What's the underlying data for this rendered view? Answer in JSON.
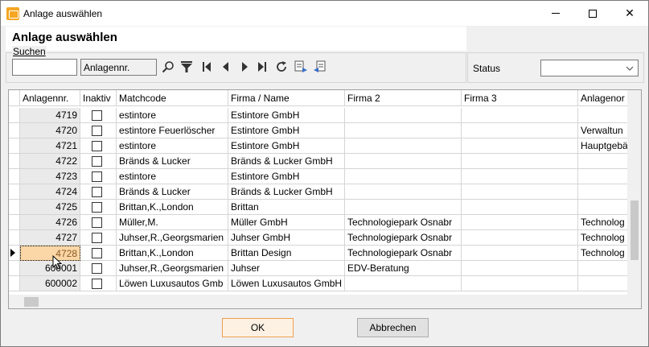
{
  "window": {
    "title": "Anlage auswählen"
  },
  "page": {
    "title": "Anlage auswählen"
  },
  "search": {
    "legend": "Suchen",
    "value": "",
    "field": "Anlagennr."
  },
  "status": {
    "label": "Status",
    "value": ""
  },
  "columns": [
    "Anlagennr.",
    "Inaktiv",
    "Matchcode",
    "Firma / Name",
    "Firma 2",
    "Firma 3",
    "Anlagenor"
  ],
  "rows": [
    {
      "nr": "4719",
      "matchcode": "estintore",
      "firma": "Estintore GmbH",
      "firma2": "",
      "firma3": "",
      "ort": ""
    },
    {
      "nr": "4720",
      "matchcode": "estintore Feuerlöscher",
      "firma": "Estintore GmbH",
      "firma2": "",
      "firma3": "",
      "ort": "Verwaltun"
    },
    {
      "nr": "4721",
      "matchcode": "estintore",
      "firma": "Estintore GmbH",
      "firma2": "",
      "firma3": "",
      "ort": "Hauptgebä"
    },
    {
      "nr": "4722",
      "matchcode": "Bränds & Lucker",
      "firma": "Bränds & Lucker GmbH",
      "firma2": "",
      "firma3": "",
      "ort": ""
    },
    {
      "nr": "4723",
      "matchcode": "estintore",
      "firma": "Estintore GmbH",
      "firma2": "",
      "firma3": "",
      "ort": ""
    },
    {
      "nr": "4724",
      "matchcode": "Bränds & Lucker",
      "firma": "Bränds & Lucker GmbH",
      "firma2": "",
      "firma3": "",
      "ort": ""
    },
    {
      "nr": "4725",
      "matchcode": "Brittan,K.,London",
      "firma": "Brittan",
      "firma2": "",
      "firma3": "",
      "ort": ""
    },
    {
      "nr": "4726",
      "matchcode": "Müller,M.",
      "firma": "Müller GmbH",
      "firma2": "Technologiepark Osnabr",
      "firma3": "",
      "ort": "Technolog"
    },
    {
      "nr": "4727",
      "matchcode": "Juhser,R.,Georgsmarien",
      "firma": "Juhser GmbH",
      "firma2": "Technologiepark Osnabr",
      "firma3": "",
      "ort": "Technolog"
    },
    {
      "nr": "4728",
      "matchcode": "Brittan,K.,London",
      "firma": "Brittan Design",
      "firma2": "Technologiepark Osnabr",
      "firma3": "",
      "ort": "Technolog"
    },
    {
      "nr": "600001",
      "matchcode": "Juhser,R.,Georgsmarien",
      "firma": "Juhser",
      "firma2": "EDV-Beratung",
      "firma3": "",
      "ort": ""
    },
    {
      "nr": "600002",
      "matchcode": "Löwen Luxusautos Gmb",
      "firma": "Löwen Luxusautos GmbH",
      "firma2": "",
      "firma3": "",
      "ort": ""
    }
  ],
  "buttons": {
    "ok": "OK",
    "cancel": "Abbrechen"
  }
}
